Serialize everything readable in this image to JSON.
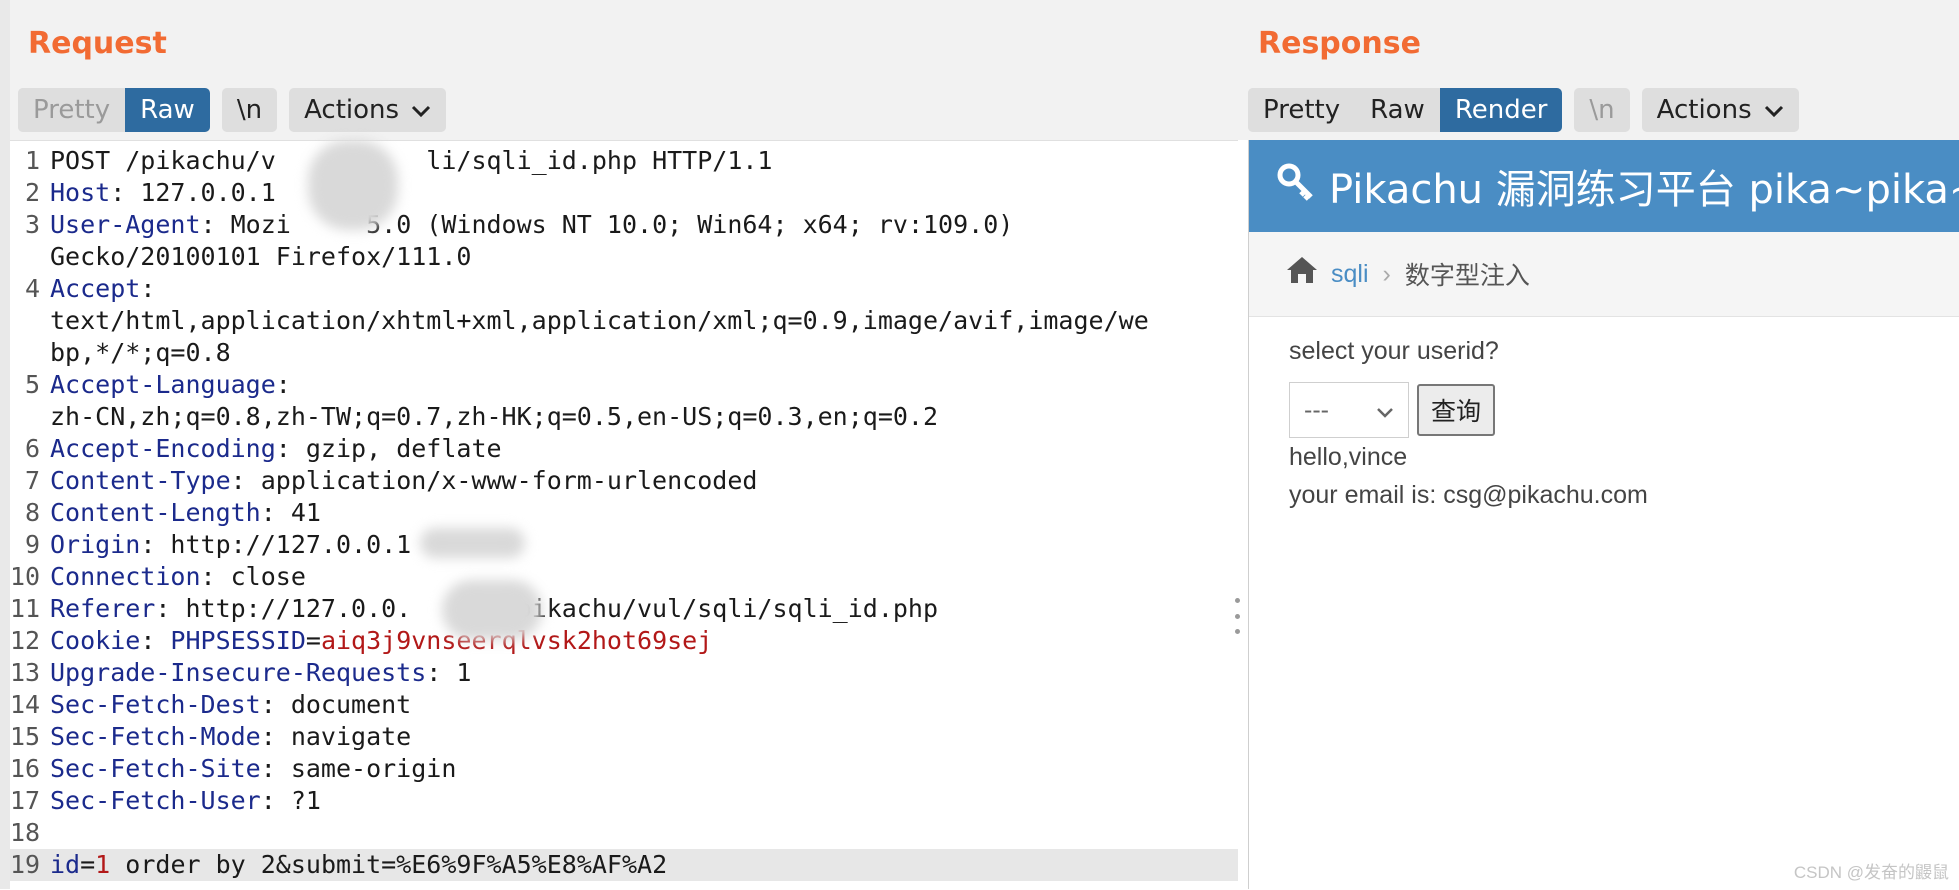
{
  "request": {
    "title": "Request",
    "tabs": [
      {
        "label": "Pretty",
        "state": "dim"
      },
      {
        "label": "Raw",
        "state": "active"
      }
    ],
    "newline_label": "\\n",
    "actions_label": "Actions",
    "lines": [
      {
        "n": "1",
        "parts": [
          {
            "t": "POST /pikachu/v",
            "c": "v"
          },
          {
            "t": "          ",
            "c": "v"
          },
          {
            "t": "li/sqli_id.php HTTP/1.1",
            "c": "v"
          }
        ]
      },
      {
        "n": "2",
        "parts": [
          {
            "t": "Host",
            "c": "k"
          },
          {
            "t": ": 127.0.0.1",
            "c": "v"
          }
        ]
      },
      {
        "n": "3",
        "parts": [
          {
            "t": "User-Agent",
            "c": "k"
          },
          {
            "t": ": Mozi     ",
            "c": "v"
          },
          {
            "t": "5.0 (Windows NT 10.0; Win64; x64; rv:109.0)",
            "c": "v"
          }
        ]
      },
      {
        "n": "",
        "parts": [
          {
            "t": "Gecko/20100101 Firefox/111.0",
            "c": "v"
          }
        ]
      },
      {
        "n": "4",
        "parts": [
          {
            "t": "Accept",
            "c": "k"
          },
          {
            "t": ":",
            "c": "v"
          }
        ]
      },
      {
        "n": "",
        "parts": [
          {
            "t": "text/html,application/xhtml+xml,application/xml;q=0.9,image/avif,image/we",
            "c": "v"
          }
        ]
      },
      {
        "n": "",
        "parts": [
          {
            "t": "bp,*/*;q=0.8",
            "c": "v"
          }
        ]
      },
      {
        "n": "5",
        "parts": [
          {
            "t": "Accept-Language",
            "c": "k"
          },
          {
            "t": ":",
            "c": "v"
          }
        ]
      },
      {
        "n": "",
        "parts": [
          {
            "t": "zh-CN,zh;q=0.8,zh-TW;q=0.7,zh-HK;q=0.5,en-US;q=0.3,en;q=0.2",
            "c": "v"
          }
        ]
      },
      {
        "n": "6",
        "parts": [
          {
            "t": "Accept-Encoding",
            "c": "k"
          },
          {
            "t": ": gzip, deflate",
            "c": "v"
          }
        ]
      },
      {
        "n": "7",
        "parts": [
          {
            "t": "Content-Type",
            "c": "k"
          },
          {
            "t": ": application/x-www-form-urlencoded",
            "c": "v"
          }
        ]
      },
      {
        "n": "8",
        "parts": [
          {
            "t": "Content-Length",
            "c": "k"
          },
          {
            "t": ": 41",
            "c": "v"
          }
        ]
      },
      {
        "n": "9",
        "parts": [
          {
            "t": "Origin",
            "c": "k"
          },
          {
            "t": ": http://127.0.0.1",
            "c": "v"
          }
        ]
      },
      {
        "n": "10",
        "parts": [
          {
            "t": "Connection",
            "c": "k"
          },
          {
            "t": ": close",
            "c": "v"
          }
        ]
      },
      {
        "n": "11",
        "parts": [
          {
            "t": "Referer",
            "c": "k"
          },
          {
            "t": ": http://127.0.0.",
            "c": "v"
          },
          {
            "t": "      ",
            "c": "v"
          },
          {
            "t": "/pikachu/vul/sqli/sqli_id.php",
            "c": "v"
          }
        ]
      },
      {
        "n": "12",
        "parts": [
          {
            "t": "Cookie",
            "c": "k"
          },
          {
            "t": ": ",
            "c": "v"
          },
          {
            "t": "PHPSESSID",
            "c": "k"
          },
          {
            "t": "=",
            "c": "v"
          },
          {
            "t": "aiq3j9vnseerqlvsk2hot69sej",
            "c": "red"
          }
        ]
      },
      {
        "n": "13",
        "parts": [
          {
            "t": "Upgrade-Insecure-Requests",
            "c": "k"
          },
          {
            "t": ": 1",
            "c": "v"
          }
        ]
      },
      {
        "n": "14",
        "parts": [
          {
            "t": "Sec-Fetch-Dest",
            "c": "k"
          },
          {
            "t": ": document",
            "c": "v"
          }
        ]
      },
      {
        "n": "15",
        "parts": [
          {
            "t": "Sec-Fetch-Mode",
            "c": "k"
          },
          {
            "t": ": navigate",
            "c": "v"
          }
        ]
      },
      {
        "n": "16",
        "parts": [
          {
            "t": "Sec-Fetch-Site",
            "c": "k"
          },
          {
            "t": ": same-origin",
            "c": "v"
          }
        ]
      },
      {
        "n": "17",
        "parts": [
          {
            "t": "Sec-Fetch-User",
            "c": "k"
          },
          {
            "t": ": ?1",
            "c": "v"
          }
        ]
      },
      {
        "n": "18",
        "parts": [
          {
            "t": "",
            "c": "v"
          }
        ]
      },
      {
        "n": "19",
        "parts": [
          {
            "t": "id",
            "c": "k"
          },
          {
            "t": "=",
            "c": "v"
          },
          {
            "t": "1",
            "c": "red"
          },
          {
            "t": " order by 2&submit=%E6%9F%A5%E8%AF%A2",
            "c": "v"
          }
        ]
      }
    ]
  },
  "response": {
    "title": "Response",
    "tabs": [
      {
        "label": "Pretty",
        "state": ""
      },
      {
        "label": "Raw",
        "state": ""
      },
      {
        "label": "Render",
        "state": "active"
      }
    ],
    "newline_label": "\\n",
    "actions_label": "Actions",
    "render": {
      "site_title": "Pikachu 漏洞练习平台 pika~pika~",
      "breadcrumb_link": "sqli",
      "breadcrumb_current": "数字型注入",
      "question": "select your userid?",
      "select_value": "---",
      "query_button": "查询",
      "hello": "hello,vince",
      "email": "your email is: csg@pikachu.com"
    }
  },
  "watermark": "CSDN @发奋的鼹鼠"
}
